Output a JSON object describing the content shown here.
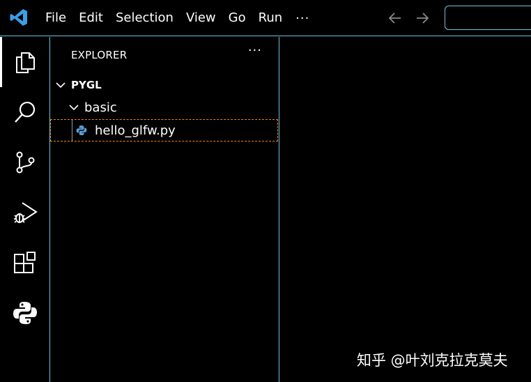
{
  "menu": {
    "items": [
      "File",
      "Edit",
      "Selection",
      "View",
      "Go",
      "Run"
    ],
    "more": "···"
  },
  "titlebar": {
    "back_icon": "arrow-left-icon",
    "forward_icon": "arrow-right-icon"
  },
  "activity_bar": {
    "items": [
      {
        "icon": "explorer-icon",
        "active": true
      },
      {
        "icon": "search-icon",
        "active": false
      },
      {
        "icon": "source-control-icon",
        "active": false
      },
      {
        "icon": "run-debug-icon",
        "active": false
      },
      {
        "icon": "extensions-icon",
        "active": false
      },
      {
        "icon": "python-icon",
        "active": false
      }
    ]
  },
  "sidebar": {
    "title": "EXPLORER",
    "more": "···",
    "tree": {
      "root": "PYGL",
      "folder": "basic",
      "file": "hello_glfw.py"
    }
  },
  "colors": {
    "accent_border": "#6fc3df",
    "focus_outline": "#f38518",
    "vscode_blue": "#3b9ee8",
    "python_blue": "#5b9fd6"
  },
  "watermark": "知乎 @叶刘克拉克莫夫"
}
